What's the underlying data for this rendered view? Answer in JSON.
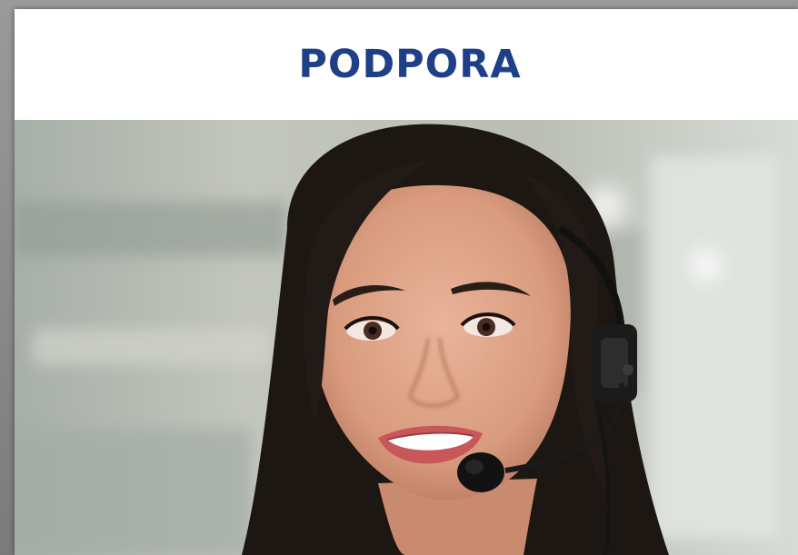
{
  "header": {
    "title": "PODPORA"
  },
  "photo": {
    "alt_subject": "support-agent-with-headset"
  },
  "colors": {
    "title": "#1f3f86",
    "card_background": "#ffffff"
  }
}
